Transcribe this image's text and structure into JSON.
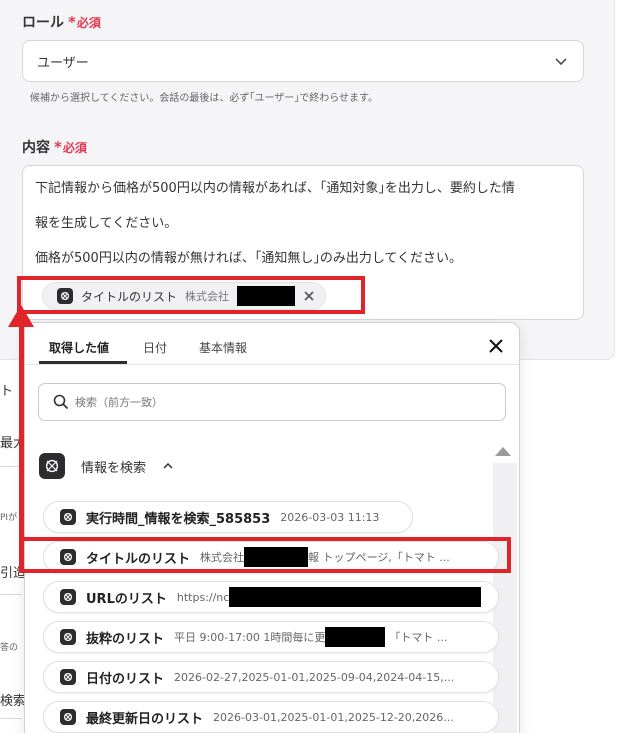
{
  "role_field": {
    "label": "ロール",
    "required_star": "*",
    "required_text": "必須",
    "selected_value": "ユーザー",
    "hint": "候補から選択してください。会話の最後は、必ず｢ユーザー｣で終わらせます。"
  },
  "content_field": {
    "label": "内容",
    "required_star": "*",
    "required_text": "必須",
    "lines": [
      "下記情報から価格が500円以内の情報があれば、｢通知対象｣を出力し、要約した情",
      "報を生成してください。",
      "価格が500円以内の情報が無ければ、｢通知無し｣のみ出力してください。"
    ],
    "inserted_chip": {
      "name": "タイトルのリスト",
      "value": "株式会社"
    }
  },
  "popup": {
    "tabs": [
      "取得した値",
      "日付",
      "基本情報"
    ],
    "active_tab": 0,
    "search_placeholder": "検索（前方一致）",
    "group_title": "情報を検索",
    "items": [
      {
        "name": "実行時間_情報を検索_585853",
        "value": "2026-03-03 11:13"
      },
      {
        "name": "タイトルのリスト",
        "value": "株式会社",
        "value_suffix": "報 トップページ,「トマト ..."
      },
      {
        "name": "URLのリスト",
        "value": "https://nc"
      },
      {
        "name": "抜粋のリスト",
        "value": "平日 9:00-17:00 1時間毎に更",
        "value_suffix": "「トマト ..."
      },
      {
        "name": "日付のリスト",
        "value": "2026-02-27,2025-01-01,2025-09-04,2024-04-15,..."
      },
      {
        "name": "最終更新日のリスト",
        "value": "2026-03-01,2025-01-01,2025-12-20,2026..."
      }
    ]
  },
  "left_peek": {
    "items": [
      "ト",
      "最大",
      "PIが",
      "引造",
      "答の",
      "検索"
    ]
  },
  "colors": {
    "required": "#e53950",
    "highlight": "#e0242a",
    "app_icon_bg": "#2d2d2f"
  }
}
